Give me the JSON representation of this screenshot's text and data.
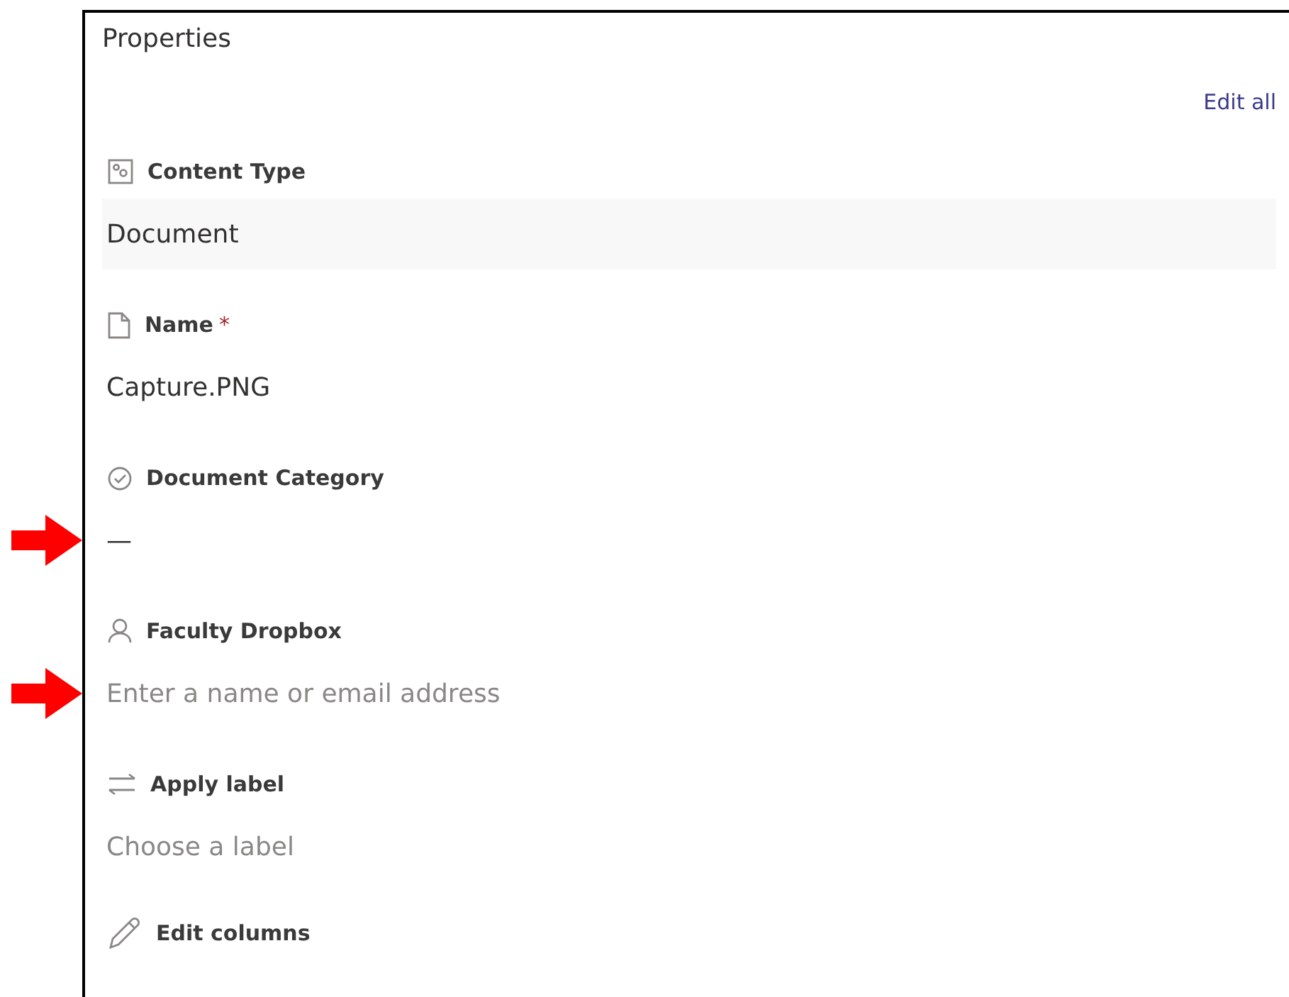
{
  "panel": {
    "title": "Properties",
    "edit_all": "Edit all"
  },
  "fields": [
    {
      "kind": "content-type",
      "label": "Content Type",
      "value": "Document",
      "marked": false
    },
    {
      "kind": "file",
      "label": "Name",
      "required_mark": "*",
      "value": "Capture.PNG",
      "marked": false
    },
    {
      "kind": "choice",
      "label": "Document Category",
      "value": "—",
      "marked": true
    },
    {
      "kind": "person",
      "label": "Faculty Dropbox",
      "placeholder": "Enter a name or email address",
      "marked": true
    },
    {
      "kind": "label",
      "label": "Apply label",
      "placeholder": "Choose a label",
      "marked": false
    }
  ],
  "edit_columns": "Edit columns"
}
